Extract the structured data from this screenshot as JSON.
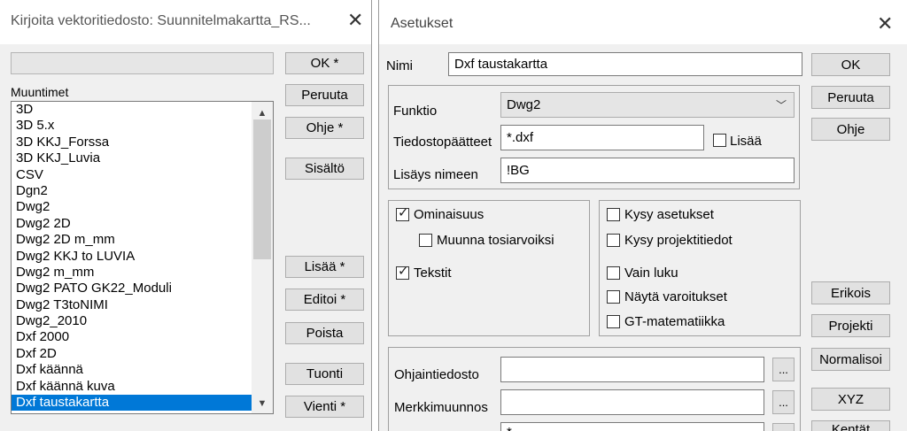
{
  "left_dialog": {
    "title": "Kirjoita vektoritiedosto: Suunnitelmakartta_RS...",
    "close_icon": "close-icon",
    "path_value": "",
    "list_label": "Muuntimet",
    "items": [
      "3D",
      "3D 5.x",
      "3D KKJ_Forssa",
      "3D KKJ_Luvia",
      "CSV",
      "Dgn2",
      "Dwg2",
      "Dwg2 2D",
      "Dwg2 2D m_mm",
      "Dwg2 KKJ to LUVIA",
      "Dwg2 m_mm",
      "Dwg2 PATO GK22_Moduli",
      "Dwg2 T3toNIMI",
      "Dwg2_2010",
      "Dxf 2000",
      "Dxf 2D",
      "Dxf käännä",
      "Dxf käännä kuva",
      "Dxf taustakartta"
    ],
    "selected_item": "Dxf taustakartta",
    "buttons": {
      "ok": "OK *",
      "cancel": "Peruuta",
      "help": "Ohje *",
      "content": "Sisältö",
      "add": "Lisää *",
      "edit": "Editoi *",
      "delete": "Poista",
      "import": "Tuonti",
      "export": "Vienti *"
    }
  },
  "right_dialog": {
    "title": "Asetukset",
    "name_label": "Nimi",
    "name_value": "Dxf taustakartta",
    "function_label": "Funktio",
    "function_value": "Dwg2",
    "extension_label": "Tiedostopäätteet",
    "extension_value": "*.dxf",
    "add_checkbox_label": "Lisää",
    "add_checkbox_checked": false,
    "suffix_label": "Lisäys nimeen",
    "suffix_value": "!BG",
    "options_left": [
      {
        "label": "Ominaisuus",
        "checked": true
      },
      {
        "label": "Muunna tosiarvoiksi",
        "checked": false
      },
      {
        "label": "Tekstit",
        "checked": true
      }
    ],
    "options_right": [
      {
        "label": "Kysy asetukset",
        "checked": false
      },
      {
        "label": "Kysy projektitiedot",
        "checked": false
      },
      {
        "label": "Vain luku",
        "checked": false
      },
      {
        "label": "Näytä varoitukset",
        "checked": false
      },
      {
        "label": "GT-matematiikka",
        "checked": false
      }
    ],
    "control_file_label": "Ohjaintiedosto",
    "control_file_value": "",
    "char_conv_label": "Merkkimuunnos",
    "char_conv_value": "",
    "third_field_value": "*",
    "browse_label": "...",
    "buttons": {
      "ok": "OK",
      "cancel": "Peruuta",
      "help": "Ohje",
      "special": "Erikois",
      "project": "Projekti",
      "normalize": "Normalisoi",
      "xyz": "XYZ",
      "fields": "Kentät"
    }
  },
  "colors": {
    "selection": "#0078d7",
    "dialog_bg": "#f0f0f0"
  }
}
